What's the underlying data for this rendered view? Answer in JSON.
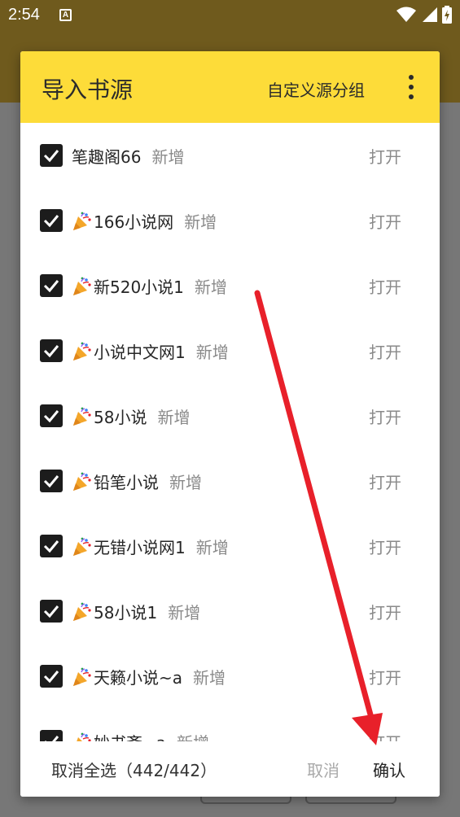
{
  "status_bar": {
    "time": "2:54",
    "notification_icon": "A",
    "icons": [
      "wifi-icon",
      "signal-icon",
      "battery-charging-icon"
    ]
  },
  "dialog": {
    "title": "导入书源",
    "custom_group_label": "自定义源分组",
    "more_icon": "more-vert-icon",
    "accent_color": "#fddc39",
    "items": [
      {
        "icon": "",
        "name": "笔趣阁66",
        "tag": "新增",
        "action": "打开",
        "checked": true
      },
      {
        "icon": "party-popper-icon",
        "name": "166小说网",
        "tag": "新增",
        "action": "打开",
        "checked": true
      },
      {
        "icon": "party-popper-icon",
        "name": "新520小说1",
        "tag": "新增",
        "action": "打开",
        "checked": true
      },
      {
        "icon": "party-popper-icon",
        "name": "小说中文网1",
        "tag": "新增",
        "action": "打开",
        "checked": true
      },
      {
        "icon": "party-popper-icon",
        "name": "58小说",
        "tag": "新增",
        "action": "打开",
        "checked": true
      },
      {
        "icon": "party-popper-icon",
        "name": "铅笔小说",
        "tag": "新增",
        "action": "打开",
        "checked": true
      },
      {
        "icon": "party-popper-icon",
        "name": "无错小说网1",
        "tag": "新增",
        "action": "打开",
        "checked": true
      },
      {
        "icon": "party-popper-icon",
        "name": "58小说1",
        "tag": "新增",
        "action": "打开",
        "checked": true
      },
      {
        "icon": "party-popper-icon",
        "name": "天籁小说~a",
        "tag": "新增",
        "action": "打开",
        "checked": true
      },
      {
        "icon": "party-popper-icon",
        "name": "妙书斋~a",
        "tag": "新增",
        "action": "打开",
        "checked": true
      }
    ],
    "footer": {
      "deselect_all": "取消全选（442/442）",
      "cancel": "取消",
      "confirm": "确认"
    }
  },
  "annotation": {
    "arrow_color": "#e8202a"
  }
}
